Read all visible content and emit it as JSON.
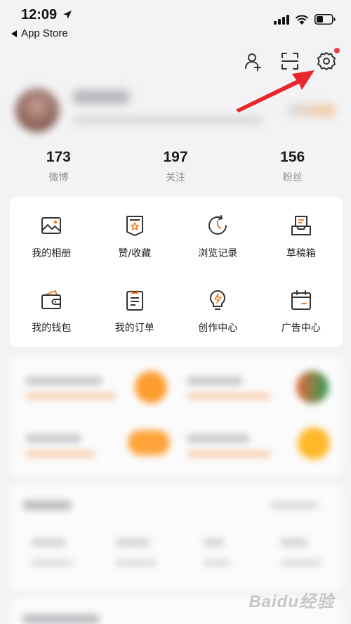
{
  "status_bar": {
    "time": "12:09",
    "back_app": "App Store"
  },
  "profile": {
    "stats": [
      {
        "value": "173",
        "label": "微博"
      },
      {
        "value": "197",
        "label": "关注"
      },
      {
        "value": "156",
        "label": "粉丝"
      }
    ]
  },
  "menu": {
    "items": [
      {
        "label": "我的相册",
        "icon": "photo-album-icon"
      },
      {
        "label": "赞/收藏",
        "icon": "favorites-icon"
      },
      {
        "label": "浏览记录",
        "icon": "history-icon"
      },
      {
        "label": "草稿箱",
        "icon": "drafts-icon"
      },
      {
        "label": "我的钱包",
        "icon": "wallet-icon"
      },
      {
        "label": "我的订单",
        "icon": "orders-icon"
      },
      {
        "label": "创作中心",
        "icon": "creator-center-icon"
      },
      {
        "label": "广告中心",
        "icon": "ad-center-icon"
      }
    ]
  },
  "watermark": "Baidu经验",
  "colors": {
    "accent": "#f07f2b",
    "arrow": "#e8262c",
    "notification": "#ee3b3b"
  }
}
